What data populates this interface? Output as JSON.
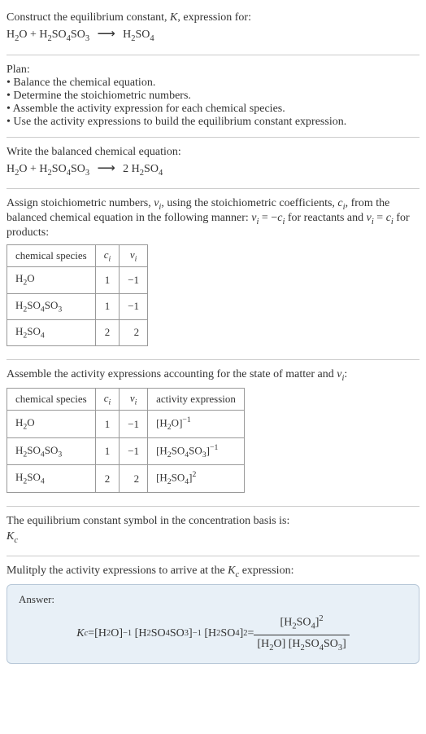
{
  "intro": {
    "line1": "Construct the equilibrium constant, ",
    "kvar": "K",
    "line1b": ", expression for:",
    "eq_lhs1": "H",
    "eq_lhs1_s2": "2",
    "eq_lhs1_o": "O + H",
    "eq_lhs2_s2": "2",
    "eq_lhs2_so4": "SO",
    "eq_lhs2_s4": "4",
    "eq_lhs2_so3": "SO",
    "eq_lhs2_s3": "3",
    "arrow": "⟶",
    "eq_rhs": "H",
    "eq_rhs_s2": "2",
    "eq_rhs_so4": "SO",
    "eq_rhs_s4": "4"
  },
  "plan": {
    "title": "Plan:",
    "items": [
      "Balance the chemical equation.",
      "Determine the stoichiometric numbers.",
      "Assemble the activity expression for each chemical species.",
      "Use the activity expressions to build the equilibrium constant expression."
    ]
  },
  "balanced": {
    "title": "Write the balanced chemical equation:",
    "coeff2": "2"
  },
  "assign": {
    "text1": "Assign stoichiometric numbers, ",
    "nu": "ν",
    "sub_i": "i",
    "text2": ", using the stoichiometric coefficients, ",
    "c": "c",
    "text3": ", from the balanced chemical equation in the following manner: ",
    "rel1a": "ν",
    "rel1b": " = −",
    "rel1c": "c",
    "text4": " for reactants and ",
    "rel2a": "ν",
    "rel2b": " = ",
    "rel2c": "c",
    "text5": " for products:"
  },
  "table1": {
    "h1": "chemical species",
    "h2": "c",
    "h2s": "i",
    "h3": "ν",
    "h3s": "i",
    "rows": [
      {
        "sp": "H2O",
        "c": "1",
        "n": "−1"
      },
      {
        "sp": "H2SO4SO3",
        "c": "1",
        "n": "−1"
      },
      {
        "sp": "H2SO4",
        "c": "2",
        "n": "2"
      }
    ]
  },
  "assemble": {
    "text1": "Assemble the activity expressions accounting for the state of matter and ",
    "nu": "ν",
    "sub_i": "i",
    "text2": ":"
  },
  "table2": {
    "h1": "chemical species",
    "h2": "c",
    "h2s": "i",
    "h3": "ν",
    "h3s": "i",
    "h4": "activity expression",
    "row1": {
      "c": "1",
      "n": "−1",
      "exp": "−1"
    },
    "row2": {
      "c": "1",
      "n": "−1",
      "exp": "−1"
    },
    "row3": {
      "c": "2",
      "n": "2",
      "exp": "2"
    }
  },
  "symbol": {
    "line1": "The equilibrium constant symbol in the concentration basis is:",
    "kc": "K",
    "kcs": "c"
  },
  "multiply": {
    "text": "Mulitply the activity expressions to arrive at the ",
    "kc": "K",
    "kcs": "c",
    "text2": " expression:"
  },
  "answer": {
    "label": "Answer:",
    "kc": "K",
    "kcs": "c",
    "eq": " = ",
    "expN1": "−1",
    "expN1b": "−1",
    "exp2": "2",
    "exp2b": "2"
  },
  "species": {
    "h2o_h": "H",
    "h2o_2": "2",
    "h2o_o": "O",
    "h2so4so3_h": "H",
    "h2so4so3_2": "2",
    "h2so4so3_so": "SO",
    "h2so4so3_4": "4",
    "h2so4so3_so2": "SO",
    "h2so4so3_3": "3",
    "h2so4_h": "H",
    "h2so4_2": "2",
    "h2so4_so": "SO",
    "h2so4_4": "4"
  }
}
